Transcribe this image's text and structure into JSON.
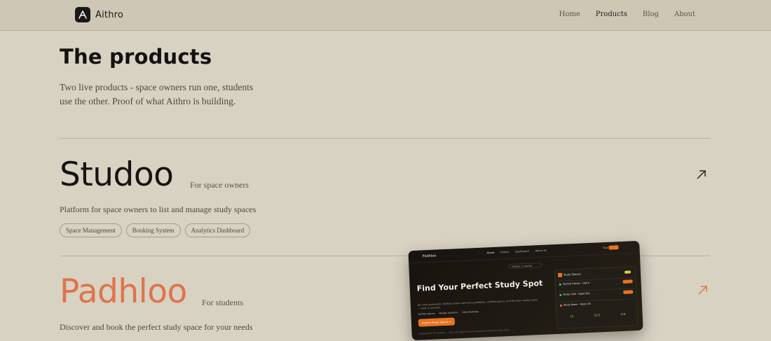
{
  "nav": {
    "brand": "Aithro",
    "links": [
      {
        "label": "Home"
      },
      {
        "label": "Products"
      },
      {
        "label": "Blog"
      },
      {
        "label": "About"
      }
    ]
  },
  "header": {
    "title": "The products",
    "intro": "Two live products - space owners run one, students use the other. Proof of what Aithro is building."
  },
  "products": [
    {
      "name": "Studoo",
      "tagline": "For space owners",
      "description": "Platform for space owners to list and manage study spaces",
      "tags": [
        "Space Management",
        "Booking System",
        "Analytics Dashboard"
      ],
      "name_color": "#161412",
      "arrow_color": "#2a2723"
    },
    {
      "name": "Padhloo",
      "tagline": "For students",
      "description": "Discover and book the perfect study space for your needs",
      "name_color": "#e0744a",
      "arrow_color": "#e0744a",
      "preview": {
        "brand": "Padhloo",
        "nav": [
          "Home",
          "Rooms",
          "Dashboard",
          "About Us"
        ],
        "signin": "Sign in",
        "city": "Padhloo in new Nal",
        "hero": "Find Your Perfect Study Spot",
        "sub": "No more guesswork. Padhloo shows real-time availability, verified spaces, and the best nearby spots — book in seconds.",
        "features": [
          "Verified spaces",
          "Nearby locations",
          "Daily Bookings"
        ],
        "cta": "Explore Study Spaces →",
        "trust": "Designed for IIT students — with real insights from thousands of learners across India.",
        "panel_title": "Study Spaces",
        "rows": [
          "Central Library - Hall A",
          "Study Cafe - Night Out",
          "Study Room - Room 02"
        ],
        "stats": [
          "12",
          "10.5",
          "4.8"
        ]
      }
    }
  ],
  "colors": {
    "background": "#d8d2c3",
    "accent": "#e0744a",
    "cta": "#e8741f"
  }
}
